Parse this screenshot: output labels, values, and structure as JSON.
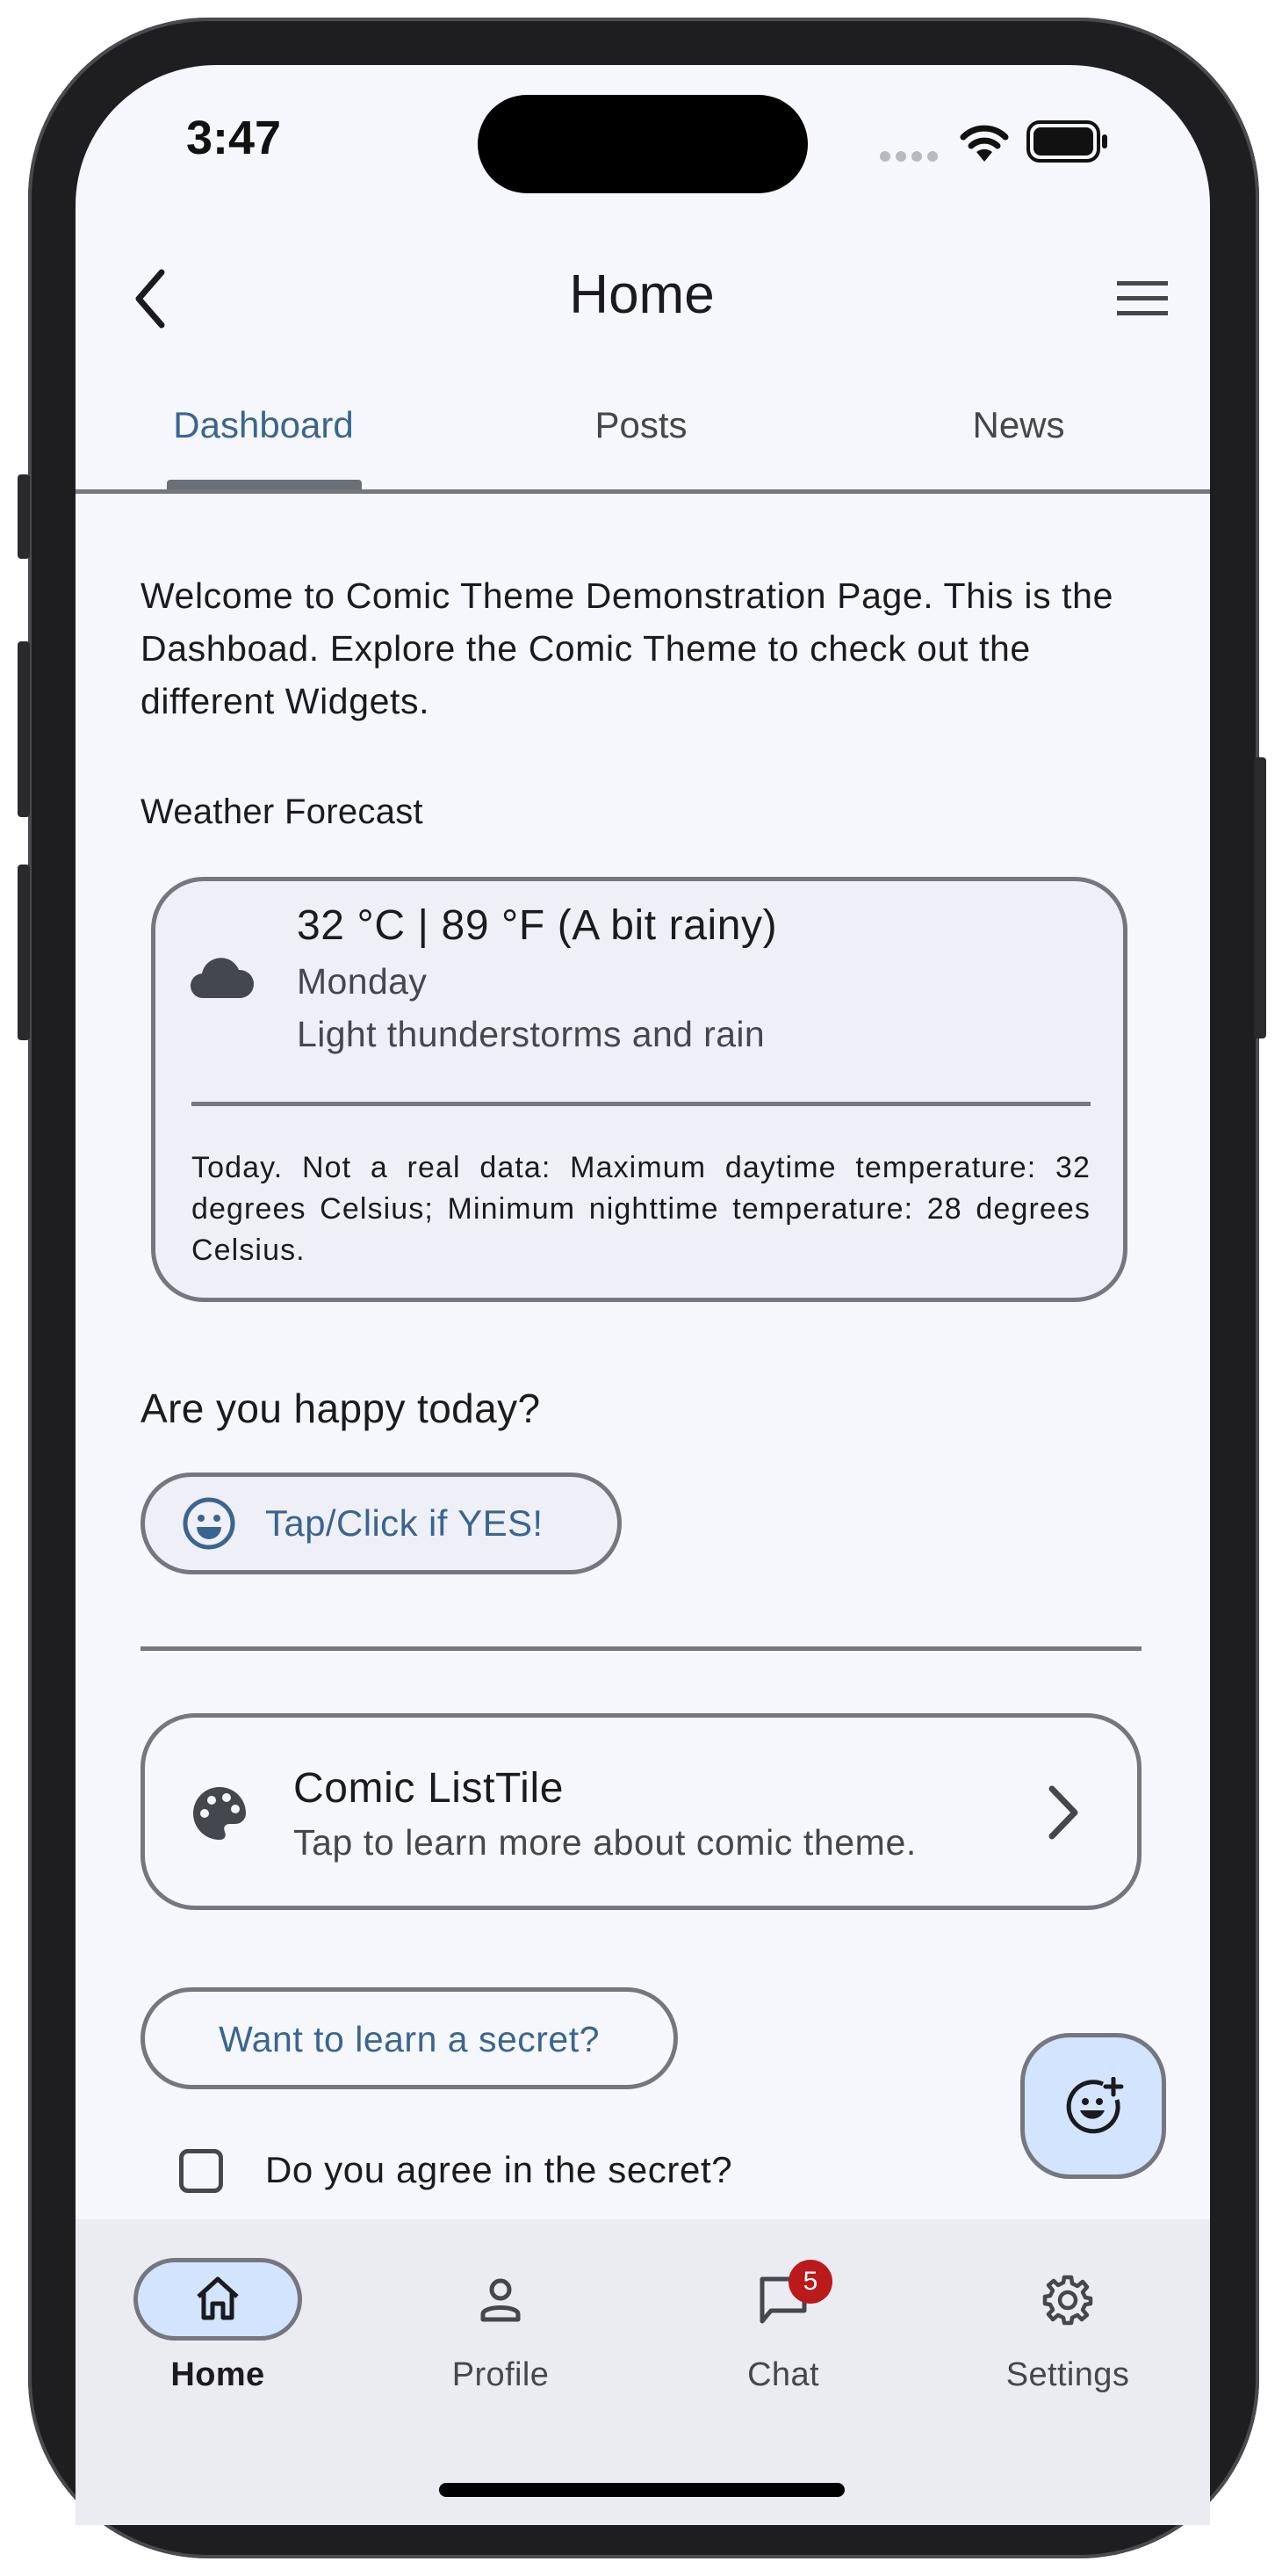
{
  "status_bar": {
    "time": "3:47"
  },
  "app_bar": {
    "title": "Home"
  },
  "tabs": [
    {
      "label": "Dashboard",
      "selected": true
    },
    {
      "label": "Posts",
      "selected": false
    },
    {
      "label": "News",
      "selected": false
    }
  ],
  "welcome_text": "Welcome to Comic Theme Demonstration Page. This is the Dashboad. Explore the Comic Theme to check out the different Widgets.",
  "weather": {
    "heading": "Weather Forecast",
    "temperature": "32 °C | 89 °F (A bit rainy)",
    "day": "Monday",
    "condition": "Light thunderstorms and rain",
    "icon": "cloud-icon",
    "detail": "Today. Not a real data: Maximum daytime temperature: 32 degrees Celsius; Minimum nighttime temperature: 28 degrees Celsius."
  },
  "happy": {
    "question": "Are you happy today?",
    "button_label": "Tap/Click if YES!",
    "icon": "smile-icon"
  },
  "list_tile": {
    "title": "Comic ListTile",
    "subtitle": "Tap to learn more about comic theme.",
    "icon": "palette-icon"
  },
  "secret": {
    "button_label": "Want to learn a secret?",
    "checkbox_label": "Do you agree in the secret?",
    "checked": false
  },
  "fab": {
    "icon": "add-reaction-icon"
  },
  "bottom_nav": {
    "items": [
      {
        "label": "Home",
        "icon": "home-icon",
        "selected": true
      },
      {
        "label": "Profile",
        "icon": "person-icon",
        "selected": false
      },
      {
        "label": "Chat",
        "icon": "chat-icon",
        "selected": false,
        "badge": "5"
      },
      {
        "label": "Settings",
        "icon": "gear-icon",
        "selected": false
      }
    ]
  },
  "colors": {
    "accent": "#3a6590",
    "background": "#f6f7fd",
    "card": "#eff0f7",
    "outline": "#74777f",
    "selected_container": "#d3e4ff",
    "badge": "#ba1a1a"
  }
}
